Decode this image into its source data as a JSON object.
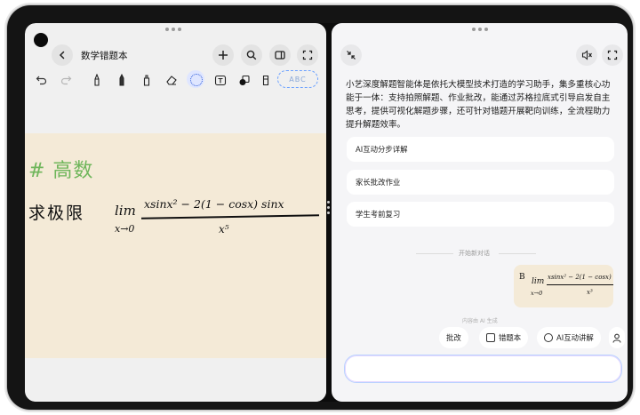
{
  "left_pane": {
    "title": "数学错题本",
    "abc_label": "ABC",
    "note": {
      "tag": "# 高数",
      "prompt": "求极限",
      "lim": "lim",
      "limit_var": "x→0",
      "numerator": "xsinx² − 2(1 − cosx) sinx",
      "denominator": "x⁵"
    }
  },
  "right_pane": {
    "intro": "小艺深度解题智能体是依托大模型技术打造的学习助手，集多重核心功能于一体：支持拍照解题、作业批改，能通过苏格拉底式引导启发自主思考，提供可视化解题步骤，还可针对错题开展靶向训练，全流程助力提升解题效率。",
    "suggestions": [
      "AI互动分步详解",
      "家长批改作业",
      "学生考前复习"
    ],
    "new_chat_label": "开始新对话",
    "ai_generated_label": "内容由 AI 生成",
    "thumb": {
      "lim": "lim",
      "limit_var": "x→0",
      "numerator": "xsinx² − 2(1 − cosx) sinx",
      "denominator": "x³"
    },
    "actions": [
      {
        "label": "批改",
        "icon": "pencil-icon"
      },
      {
        "label": "错题本",
        "icon": "notebook-icon"
      },
      {
        "label": "AI互动讲解",
        "icon": "ai-chat-icon"
      }
    ],
    "input_placeholder": ""
  },
  "colors": {
    "paper": "#f4ead7",
    "green_ink": "#6fb65b",
    "accent_blue": "#2d5bd9"
  }
}
